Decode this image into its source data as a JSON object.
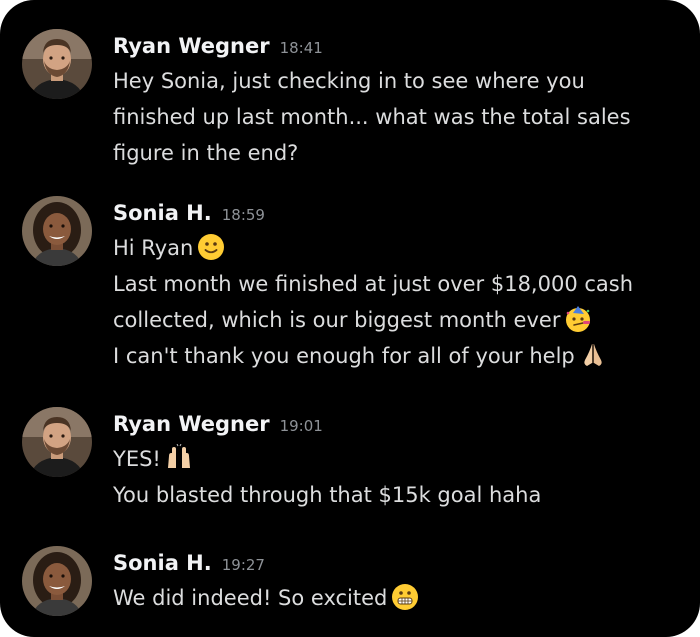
{
  "messages": [
    {
      "author": "Ryan Wegner",
      "time": "18:41",
      "lines": [
        "Hey Sonia, just checking in to see where you",
        "finished up last month... what was the total sales",
        "figure in the end?"
      ],
      "avatar_icon": "man-avatar"
    },
    {
      "author": "Sonia H.",
      "time": "18:59",
      "lines": [
        "Hi Ryan",
        "Last month we finished at just over $18,000 cash",
        "collected, which is our biggest month ever",
        "I can't thank you enough for all of your help"
      ],
      "avatar_icon": "woman-avatar",
      "emojis": [
        "slightly-smiling-face-emoji",
        "partying-face-emoji",
        "folded-hands-emoji"
      ]
    },
    {
      "author": "Ryan Wegner",
      "time": "19:01",
      "lines": [
        "YES!",
        "You blasted through that $15k goal haha"
      ],
      "avatar_icon": "man-avatar",
      "emojis": [
        "raising-hands-emoji"
      ]
    },
    {
      "author": "Sonia H.",
      "time": "19:27",
      "lines": [
        "We did indeed! So excited"
      ],
      "avatar_icon": "woman-avatar",
      "emojis": [
        "grimacing-face-emoji"
      ]
    }
  ],
  "colors": {
    "background": "#000000",
    "author_text": "#f2f3f5",
    "timestamp_text": "#8e9297",
    "message_text": "#dcddde"
  }
}
